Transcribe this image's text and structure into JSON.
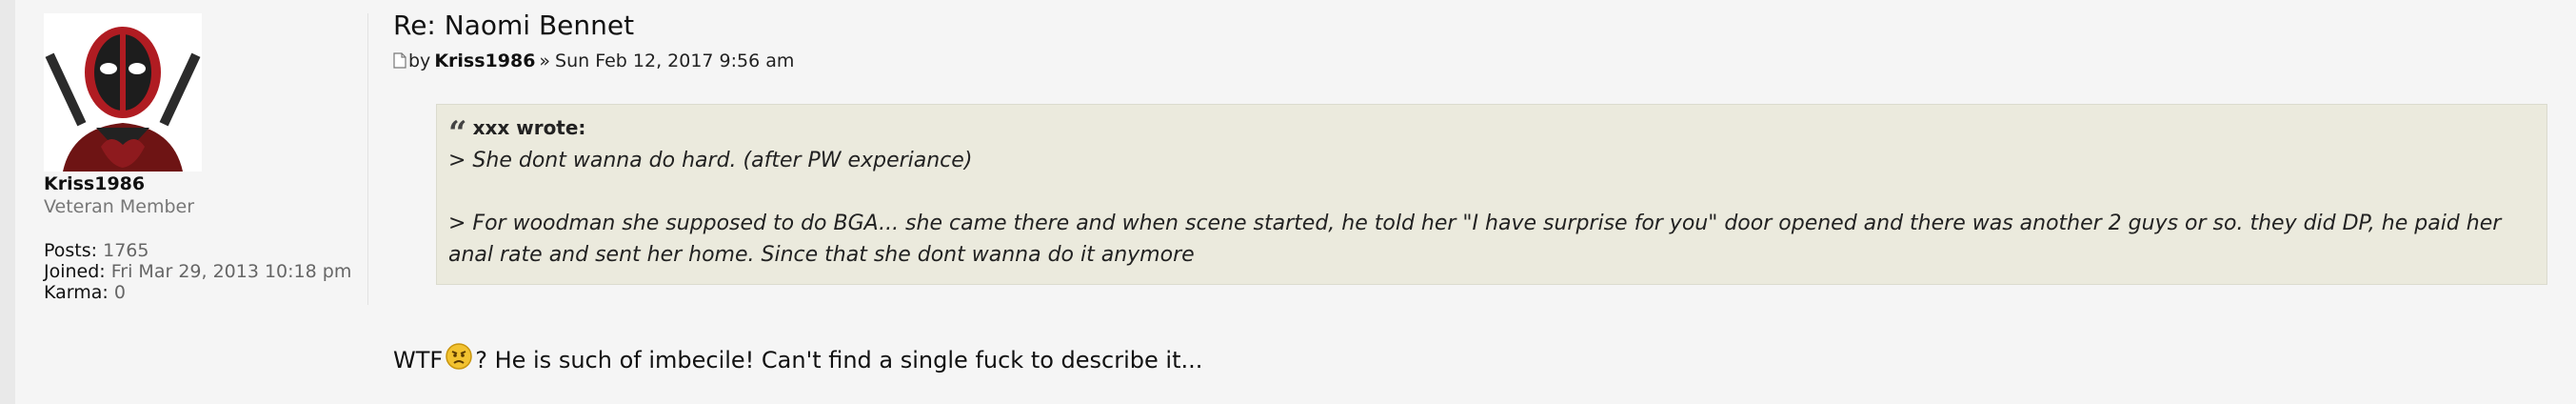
{
  "profile": {
    "username": "Kriss1986",
    "rank": "Veteran Member",
    "posts_label": "Posts:",
    "posts_value": "1765",
    "joined_label": "Joined:",
    "joined_value": "Fri Mar 29, 2013 10:18 pm",
    "karma_label": "Karma:",
    "karma_value": "0"
  },
  "post": {
    "title": "Re: Naomi Bennet",
    "by_label": "by",
    "author": "Kriss1986",
    "separator": "»",
    "timestamp": "Sun Feb 12, 2017 9:56 am"
  },
  "quote": {
    "cite": "xxx wrote:",
    "line1": "> She dont wanna do hard. (after PW experiance)",
    "line2": "> For woodman she supposed to do BGA... she came there and when scene started, he told her \"I have surprise for you\" door opened and there was another 2 guys or so. they did DP, he paid her anal rate and sent her home. Since that she dont wanna do it anymore"
  },
  "body": {
    "before_smiley": "WTF",
    "after_smiley": "? He is such of imbecile! Can't find a single fuck to describe it..."
  },
  "colors": {
    "page_bg": "#f5f5f5",
    "quote_bg": "#ebeadd"
  }
}
